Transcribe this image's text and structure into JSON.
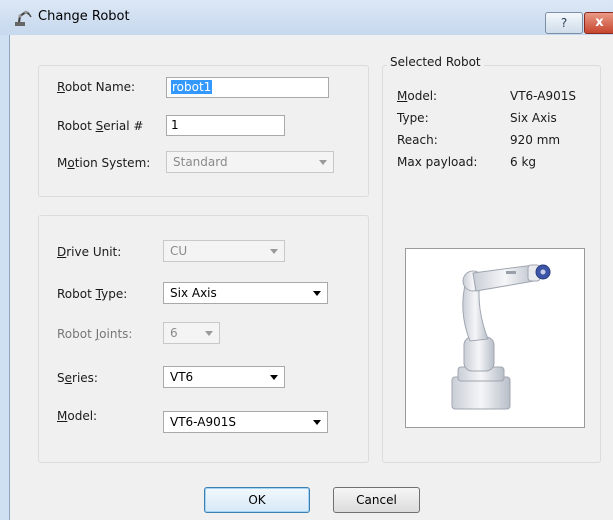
{
  "window": {
    "title": "Change Robot",
    "help_label": "?",
    "close_label": "x"
  },
  "robot_fields": {
    "name_label": {
      "pre": "",
      "ul": "R",
      "post": "obot Name:"
    },
    "name_value": "robot1",
    "serial_label": {
      "pre": "Robot ",
      "ul": "S",
      "post": "erial #"
    },
    "serial_value": "1",
    "motion_label": {
      "pre": "M",
      "ul": "o",
      "post": "tion System:"
    },
    "motion_value": "Standard"
  },
  "drive_fields": {
    "drive_unit_label": {
      "pre": "",
      "ul": "D",
      "post": "rive Unit:"
    },
    "drive_unit_value": "CU",
    "robot_type_label": {
      "pre": "Robot ",
      "ul": "T",
      "post": "ype:"
    },
    "robot_type_value": "Six Axis",
    "joints_label": {
      "pre": "Robot ",
      "ul": "J",
      "post": "oints:"
    },
    "joints_value": "6",
    "series_label": {
      "pre": "S",
      "ul": "e",
      "post": "ries:"
    },
    "series_value": "VT6",
    "model_label": {
      "pre": "",
      "ul": "M",
      "post": "odel:"
    },
    "model_value": "VT6-A901S"
  },
  "selected_robot": {
    "group_title": "Selected Robot",
    "model_label": {
      "pre": "",
      "ul": "M",
      "post": "odel:"
    },
    "model_value": "VT6-A901S",
    "type_label": "Type:",
    "type_value": "Six Axis",
    "reach_label": "Reach:",
    "reach_value": "920 mm",
    "payload_label": "Max payload:",
    "payload_value": "6 kg",
    "image_icon": "robot-arm-image"
  },
  "buttons": {
    "ok_label": "OK",
    "cancel_label": "Cancel"
  },
  "colors": {
    "title_bar": "#cfe0f2",
    "selection": "#3399ff",
    "close_button": "#c7452e"
  }
}
